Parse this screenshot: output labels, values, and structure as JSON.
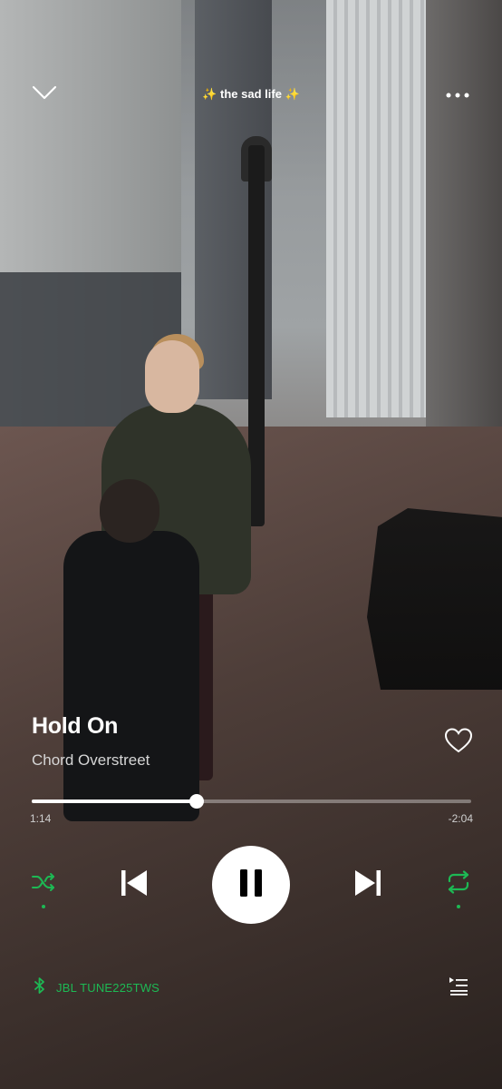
{
  "header": {
    "playlist_title": "✨ the sad life ✨"
  },
  "track": {
    "title": "Hold On",
    "artist": "Chord Overstreet",
    "liked": false
  },
  "progress": {
    "elapsed": "1:14",
    "remaining": "-2:04",
    "fraction": 0.376
  },
  "controls": {
    "shuffle_enabled": true,
    "repeat_enabled": true,
    "state": "playing"
  },
  "device": {
    "name": "JBL TUNE225TWS",
    "icon": "bluetooth-icon"
  },
  "colors": {
    "accent": "#1db954",
    "text_primary": "#ffffff",
    "text_secondary": "#d6d6d6"
  }
}
